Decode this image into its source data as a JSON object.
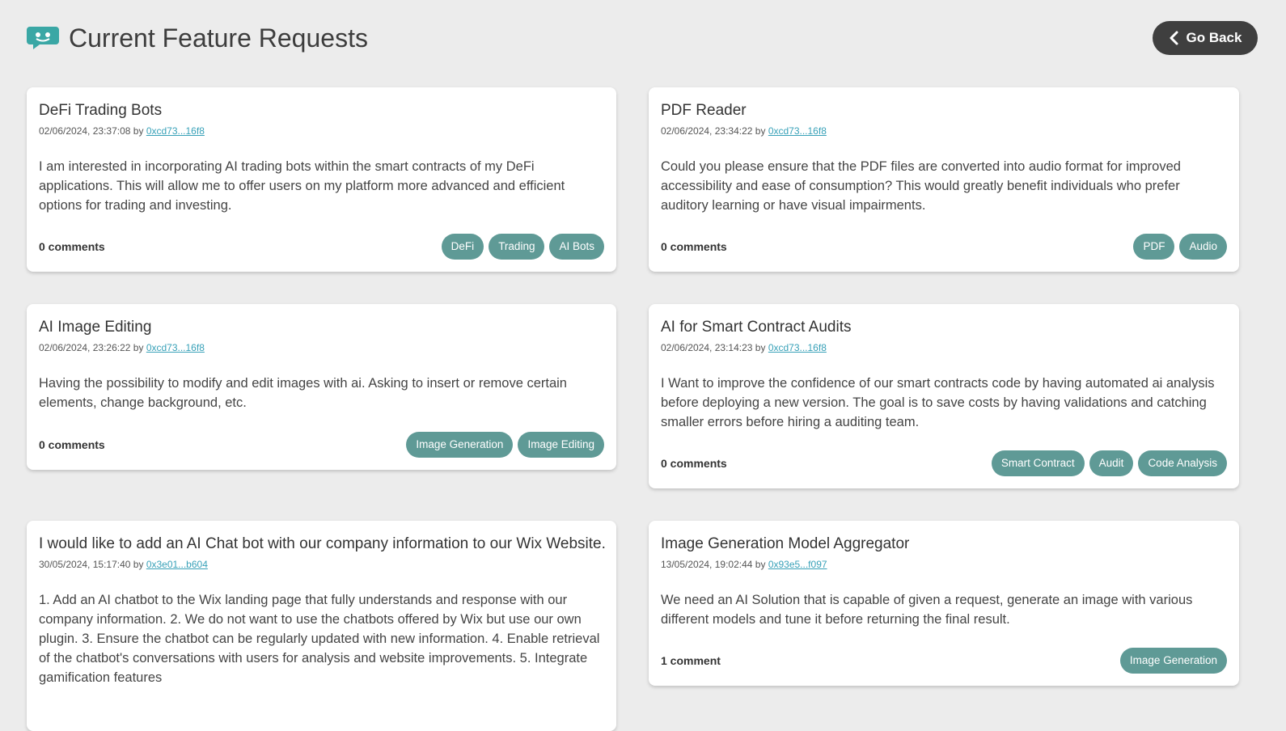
{
  "header": {
    "title": "Current Feature Requests",
    "back_label": "Go Back"
  },
  "colors": {
    "background": "#ececec",
    "accent_teal": "#3aa7a5",
    "tag": "#5f9a96",
    "back_button": "#3f3f3f",
    "link": "#38a1b8"
  },
  "requests": [
    {
      "title": "DeFi Trading Bots",
      "date": "02/06/2024, 23:37:08",
      "by": "by",
      "author": "0xcd73...16f8",
      "description": "I am interested in incorporating AI trading bots within the smart contracts of my DeFi applications. This will allow me to offer users on my platform more advanced and efficient options for trading and investing.",
      "comments": "0 comments",
      "tags": [
        "DeFi",
        "Trading",
        "AI Bots"
      ]
    },
    {
      "title": "PDF Reader",
      "date": "02/06/2024, 23:34:22",
      "by": "by",
      "author": "0xcd73...16f8",
      "description": "Could you please ensure that the PDF files are converted into audio format for improved accessibility and ease of consumption? This would greatly benefit individuals who prefer auditory learning or have visual impairments.",
      "comments": "0 comments",
      "tags": [
        "PDF",
        "Audio"
      ]
    },
    {
      "title": "AI Image Editing",
      "date": "02/06/2024, 23:26:22",
      "by": "by",
      "author": "0xcd73...16f8",
      "description": "Having the possibility to modify and edit images with ai. Asking to insert or remove certain elements, change background, etc.",
      "comments": "0 comments",
      "tags": [
        "Image Generation",
        "Image Editing"
      ]
    },
    {
      "title": "AI for Smart Contract Audits",
      "date": "02/06/2024, 23:14:23",
      "by": "by",
      "author": "0xcd73...16f8",
      "description": "I Want to improve the confidence of our smart contracts code by having automated ai analysis before deploying a new version. The goal is to save costs by having validations and catching smaller errors before hiring a auditing team.",
      "comments": "0 comments",
      "tags": [
        "Smart Contract",
        "Audit",
        "Code Analysis"
      ]
    },
    {
      "title": "I would like to add an AI Chat bot with our company information to our Wix Website.",
      "date": "30/05/2024, 15:17:40",
      "by": "by",
      "author": "0x3e01...b604",
      "description": "1. Add an AI chatbot to the Wix landing page that fully understands and response with our company information. 2. We do not want to use the chatbots offered by Wix but use our own plugin. 3. Ensure the chatbot can be regularly updated with new information. 4. Enable retrieval of the chatbot's conversations with users for analysis and website improvements. 5. Integrate gamification features",
      "comments": "",
      "tags": []
    },
    {
      "title": "Image Generation Model Aggregator",
      "date": "13/05/2024, 19:02:44",
      "by": "by",
      "author": "0x93e5...f097",
      "description": "We need an AI Solution that is capable of given a request, generate an image with various different models and tune it before returning the final result.",
      "comments": "1 comment",
      "tags": [
        "Image Generation"
      ]
    }
  ]
}
